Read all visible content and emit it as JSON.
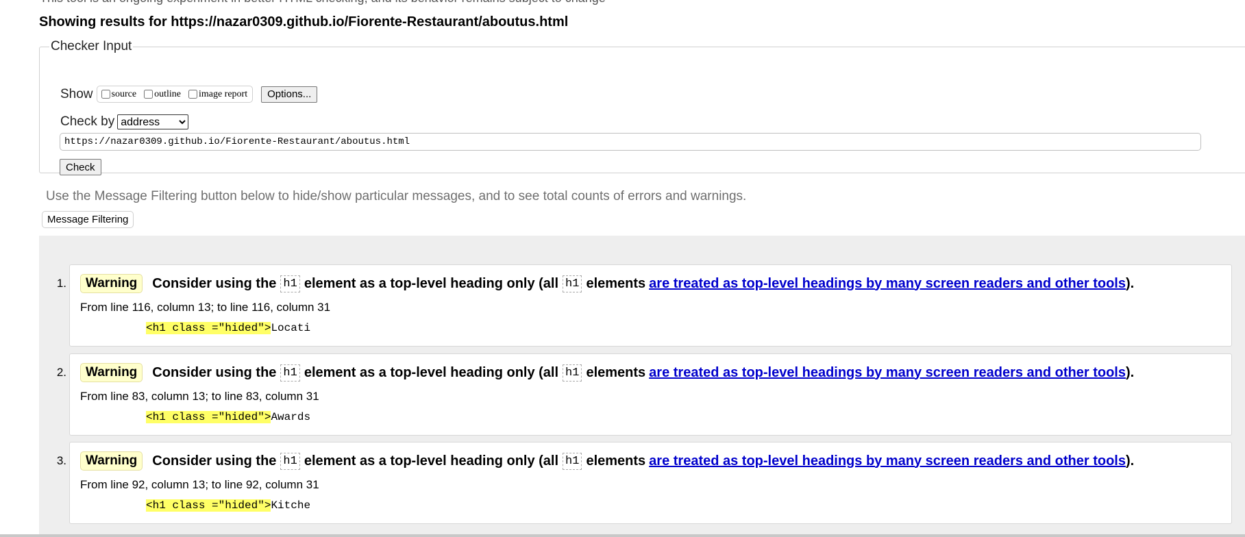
{
  "intro_cut": "This tool is an ongoing experiment in better HTML checking, and its behavior remains subject to change",
  "results_heading": "Showing results for https://nazar0309.github.io/Fiorente-Restaurant/aboutus.html",
  "checker": {
    "legend": "Checker Input",
    "show_label": "Show",
    "show_options": [
      {
        "label": "source",
        "checked": false
      },
      {
        "label": "outline",
        "checked": false
      },
      {
        "label": "image report",
        "checked": false
      }
    ],
    "options_button": "Options...",
    "check_by_label": "Check by",
    "check_by_value": "address",
    "url_value": "https://nazar0309.github.io/Fiorente-Restaurant/aboutus.html",
    "check_button": "Check"
  },
  "filter_hint": "Use the Message Filtering button below to hide/show particular messages, and to see total counts of errors and warnings.",
  "filter_button": "Message Filtering",
  "colors": {
    "warning_bg": "#ffffcc",
    "highlight": "#ffff66",
    "link": "#0000cc",
    "results_bg": "#eeeeee"
  },
  "messages": [
    {
      "number": "1.",
      "type": "Warning",
      "text_before": "Consider using the",
      "code1": "h1",
      "text_middle": "element as a top-level heading only (all",
      "code2": "h1",
      "text_after": "elements",
      "link": "are treated as top-level headings by many screen readers and other tools",
      "text_end": ").",
      "location": "From line 116, column 13; to line 116, column 31",
      "extract_highlight": "<h1 class =\"hided\">",
      "extract_rest": "Locati"
    },
    {
      "number": "2.",
      "type": "Warning",
      "text_before": "Consider using the",
      "code1": "h1",
      "text_middle": "element as a top-level heading only (all",
      "code2": "h1",
      "text_after": "elements",
      "link": "are treated as top-level headings by many screen readers and other tools",
      "text_end": ").",
      "location": "From line 83, column 13; to line 83, column 31",
      "extract_highlight": "<h1 class =\"hided\">",
      "extract_rest": "Awards"
    },
    {
      "number": "3.",
      "type": "Warning",
      "text_before": "Consider using the",
      "code1": "h1",
      "text_middle": "element as a top-level heading only (all",
      "code2": "h1",
      "text_after": "elements",
      "link": "are treated as top-level headings by many screen readers and other tools",
      "text_end": ").",
      "location": "From line 92, column 13; to line 92, column 31",
      "extract_highlight": "<h1 class =\"hided\">",
      "extract_rest": "Kitche"
    }
  ]
}
